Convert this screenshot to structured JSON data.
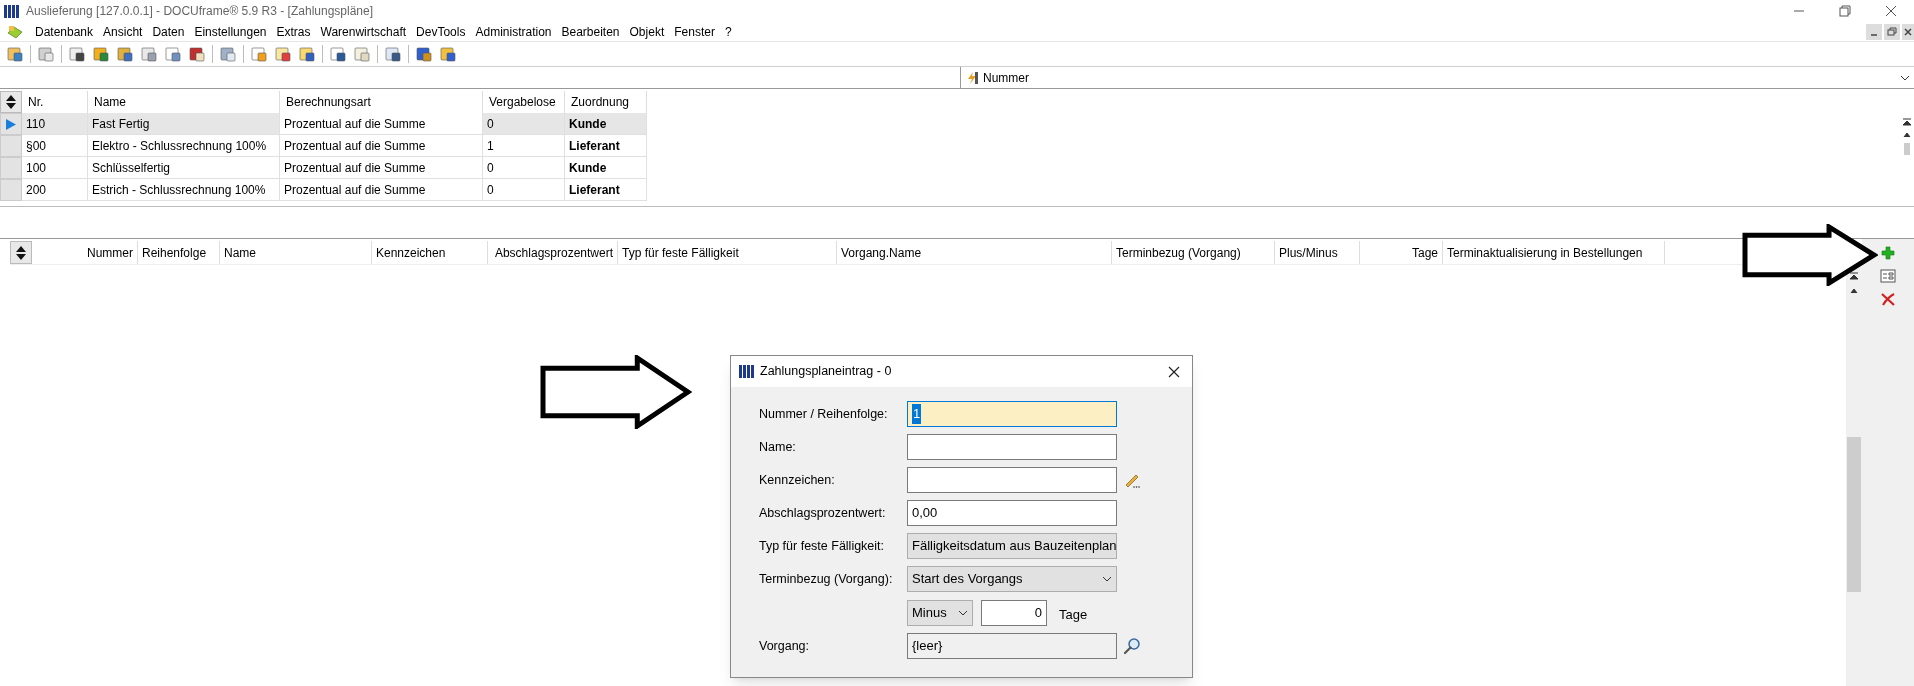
{
  "window": {
    "title": "Auslieferung [127.0.0.1] - DOCUframe® 5.9 R3 - [Zahlungspläne]"
  },
  "menu": [
    "Datenbank",
    "Ansicht",
    "Daten",
    "Einstellungen",
    "Extras",
    "Warenwirtschaft",
    "DevTools",
    "Administration",
    "Bearbeiten",
    "Objekt",
    "Fenster",
    "?"
  ],
  "filter": {
    "value": "Nummer"
  },
  "upper_table": {
    "columns": [
      "Nr.",
      "Name",
      "Berechnungsart",
      "Vergabelose",
      "Zuordnung"
    ],
    "rows": [
      {
        "cells": [
          "110",
          "Fast Fertig",
          "Prozentual auf die Summe",
          "0",
          "Kunde"
        ],
        "selected": true
      },
      {
        "cells": [
          "§00",
          "Elektro - Schlussrechnung 100%",
          "Prozentual auf die Summe",
          "1",
          "Lieferant"
        ],
        "selected": false
      },
      {
        "cells": [
          "100",
          "Schlüsselfertig",
          "Prozentual auf die Summe",
          "0",
          "Kunde"
        ],
        "selected": false
      },
      {
        "cells": [
          "200",
          "Estrich - Schlussrechnung 100%",
          "Prozentual auf die Summe",
          "0",
          "Lieferant"
        ],
        "selected": false
      }
    ]
  },
  "lower_grid": {
    "columns": [
      "Nummer",
      "Reihenfolge",
      "Name",
      "Kennzeichen",
      "Abschlagsprozentwert",
      "Typ für feste Fälligkeit",
      "Vorgang.Name",
      "Terminbezug (Vorgang)",
      "Plus/Minus",
      "Tage",
      "Terminaktualisierung in Bestellungen"
    ]
  },
  "dialog": {
    "title": "Zahlungsplaneintrag - 0",
    "fields": [
      {
        "kind": "text",
        "label": "Nummer / Reihenfolge:",
        "value": "1",
        "focused": true
      },
      {
        "kind": "text",
        "label": "Name:",
        "focused": false
      },
      {
        "kind": "edit",
        "label": "Kennzeichen:",
        "focused": false
      },
      {
        "kind": "text",
        "label": "Abschlagsprozentwert:",
        "value": "0,00",
        "focused": false
      },
      {
        "kind": "select",
        "label": "Typ für feste Fälligkeit:",
        "value": "Fälligkeitsdatum aus Bauzeitenplan"
      },
      {
        "kind": "select",
        "label": "Terminbezug (Vorgang):",
        "value": "Start des Vorgangs"
      },
      {
        "kind": "offset",
        "sign": "Minus",
        "value": "0",
        "unit": "Tage"
      },
      {
        "kind": "lookup",
        "label": "Vorgang:",
        "value": "{leer}"
      }
    ]
  }
}
